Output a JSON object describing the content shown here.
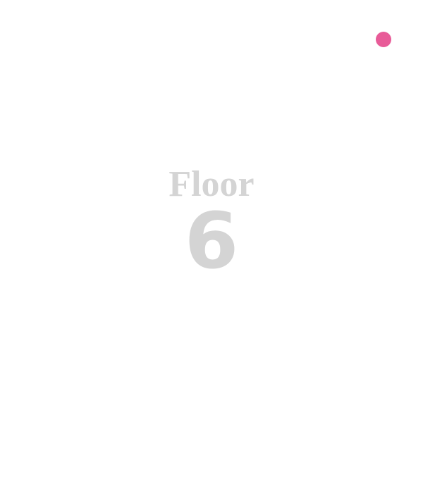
{
  "floor": {
    "label": "Floor",
    "number": "6",
    "text_color": "#d4d4d4"
  },
  "indicator": {
    "color": "#e85b98"
  }
}
